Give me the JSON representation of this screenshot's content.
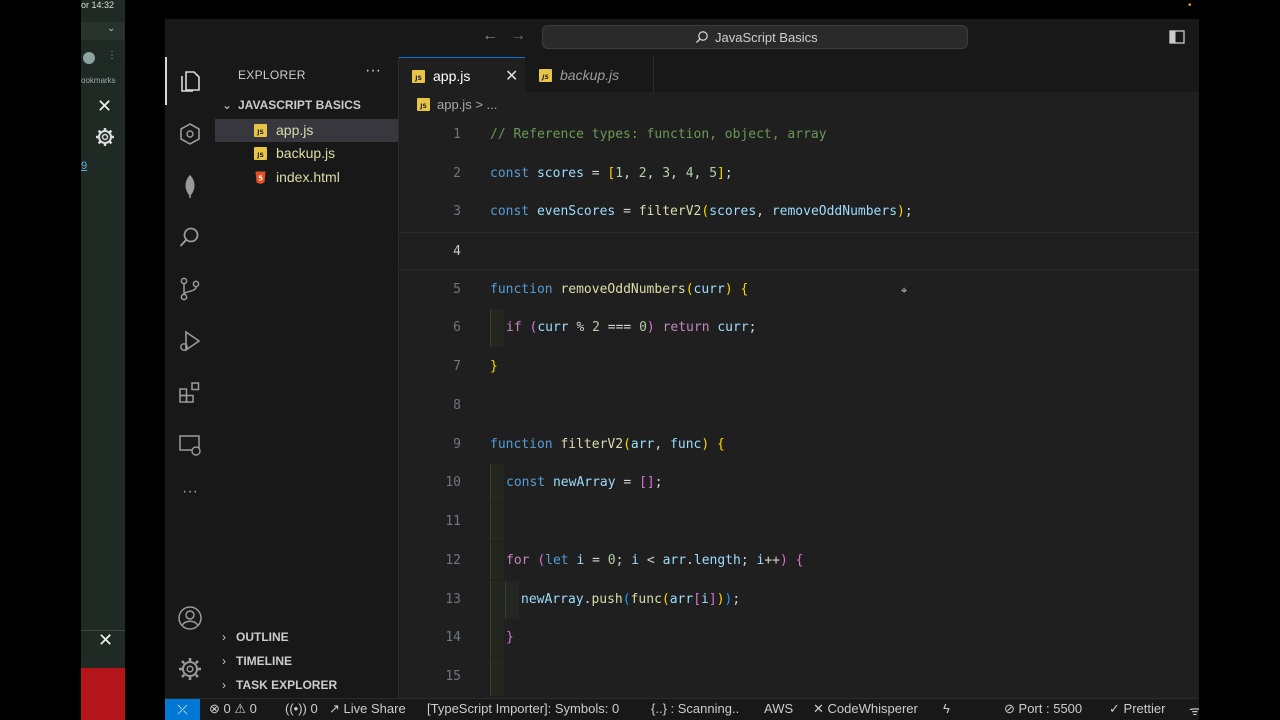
{
  "background_window": {
    "time": "or 14:32",
    "bookmarks_text": "ookmarks",
    "link_text": "9"
  },
  "window": {
    "command_center": "JavaScript Basics"
  },
  "explorer": {
    "title": "EXPLORER",
    "more": "···",
    "folder": "JAVASCRIPT BASICS",
    "files": [
      {
        "name": "app.js"
      },
      {
        "name": "backup.js"
      },
      {
        "name": "index.html"
      }
    ],
    "sections": [
      "OUTLINE",
      "TIMELINE",
      "TASK EXPLORER"
    ]
  },
  "tabs": [
    {
      "label": "app.js",
      "active": true
    },
    {
      "label": "backup.js",
      "active": false
    }
  ],
  "breadcrumb": {
    "file": "app.js",
    "sep": ">",
    "rest": "..."
  },
  "code_lines": [
    {
      "n": "1",
      "text": "// Reference types: function, object, array"
    },
    {
      "n": "2",
      "text": "const scores = [1, 2, 3, 4, 5];"
    },
    {
      "n": "3",
      "text": "const evenScores = filterV2(scores, removeOddNumbers);"
    },
    {
      "n": "4",
      "text": ""
    },
    {
      "n": "5",
      "text": "function removeOddNumbers(curr) {"
    },
    {
      "n": "6",
      "text": "if (curr % 2 === 0) return curr;"
    },
    {
      "n": "7",
      "text": "}"
    },
    {
      "n": "8",
      "text": ""
    },
    {
      "n": "9",
      "text": "function filterV2(arr, func) {"
    },
    {
      "n": "10",
      "text": "const newArray = [];"
    },
    {
      "n": "11",
      "text": ""
    },
    {
      "n": "12",
      "text": "for (let i = 0; i < arr.length; i++) {"
    },
    {
      "n": "13",
      "text": "newArray.push(func(arr[i]));"
    },
    {
      "n": "14",
      "text": "}"
    },
    {
      "n": "15",
      "text": ""
    }
  ],
  "statusbar": {
    "remote": "⤫",
    "errors": "0",
    "warnings": "0",
    "ports": "0",
    "live_share": "Live Share",
    "ts_importer": "[TypeScript Importer]: Symbols: 0",
    "scanning": "{..} : Scanning..",
    "aws": "AWS",
    "codewhisperer": "CodeWhisperer",
    "port": "Port : 5500",
    "prettier": "Prettier"
  },
  "colors": {
    "accent": "#0078d4",
    "editor_bg": "#1f1f1f",
    "sidebar_bg": "#181818",
    "js_icon": "#e8c547",
    "html_icon": "#e44d26"
  }
}
